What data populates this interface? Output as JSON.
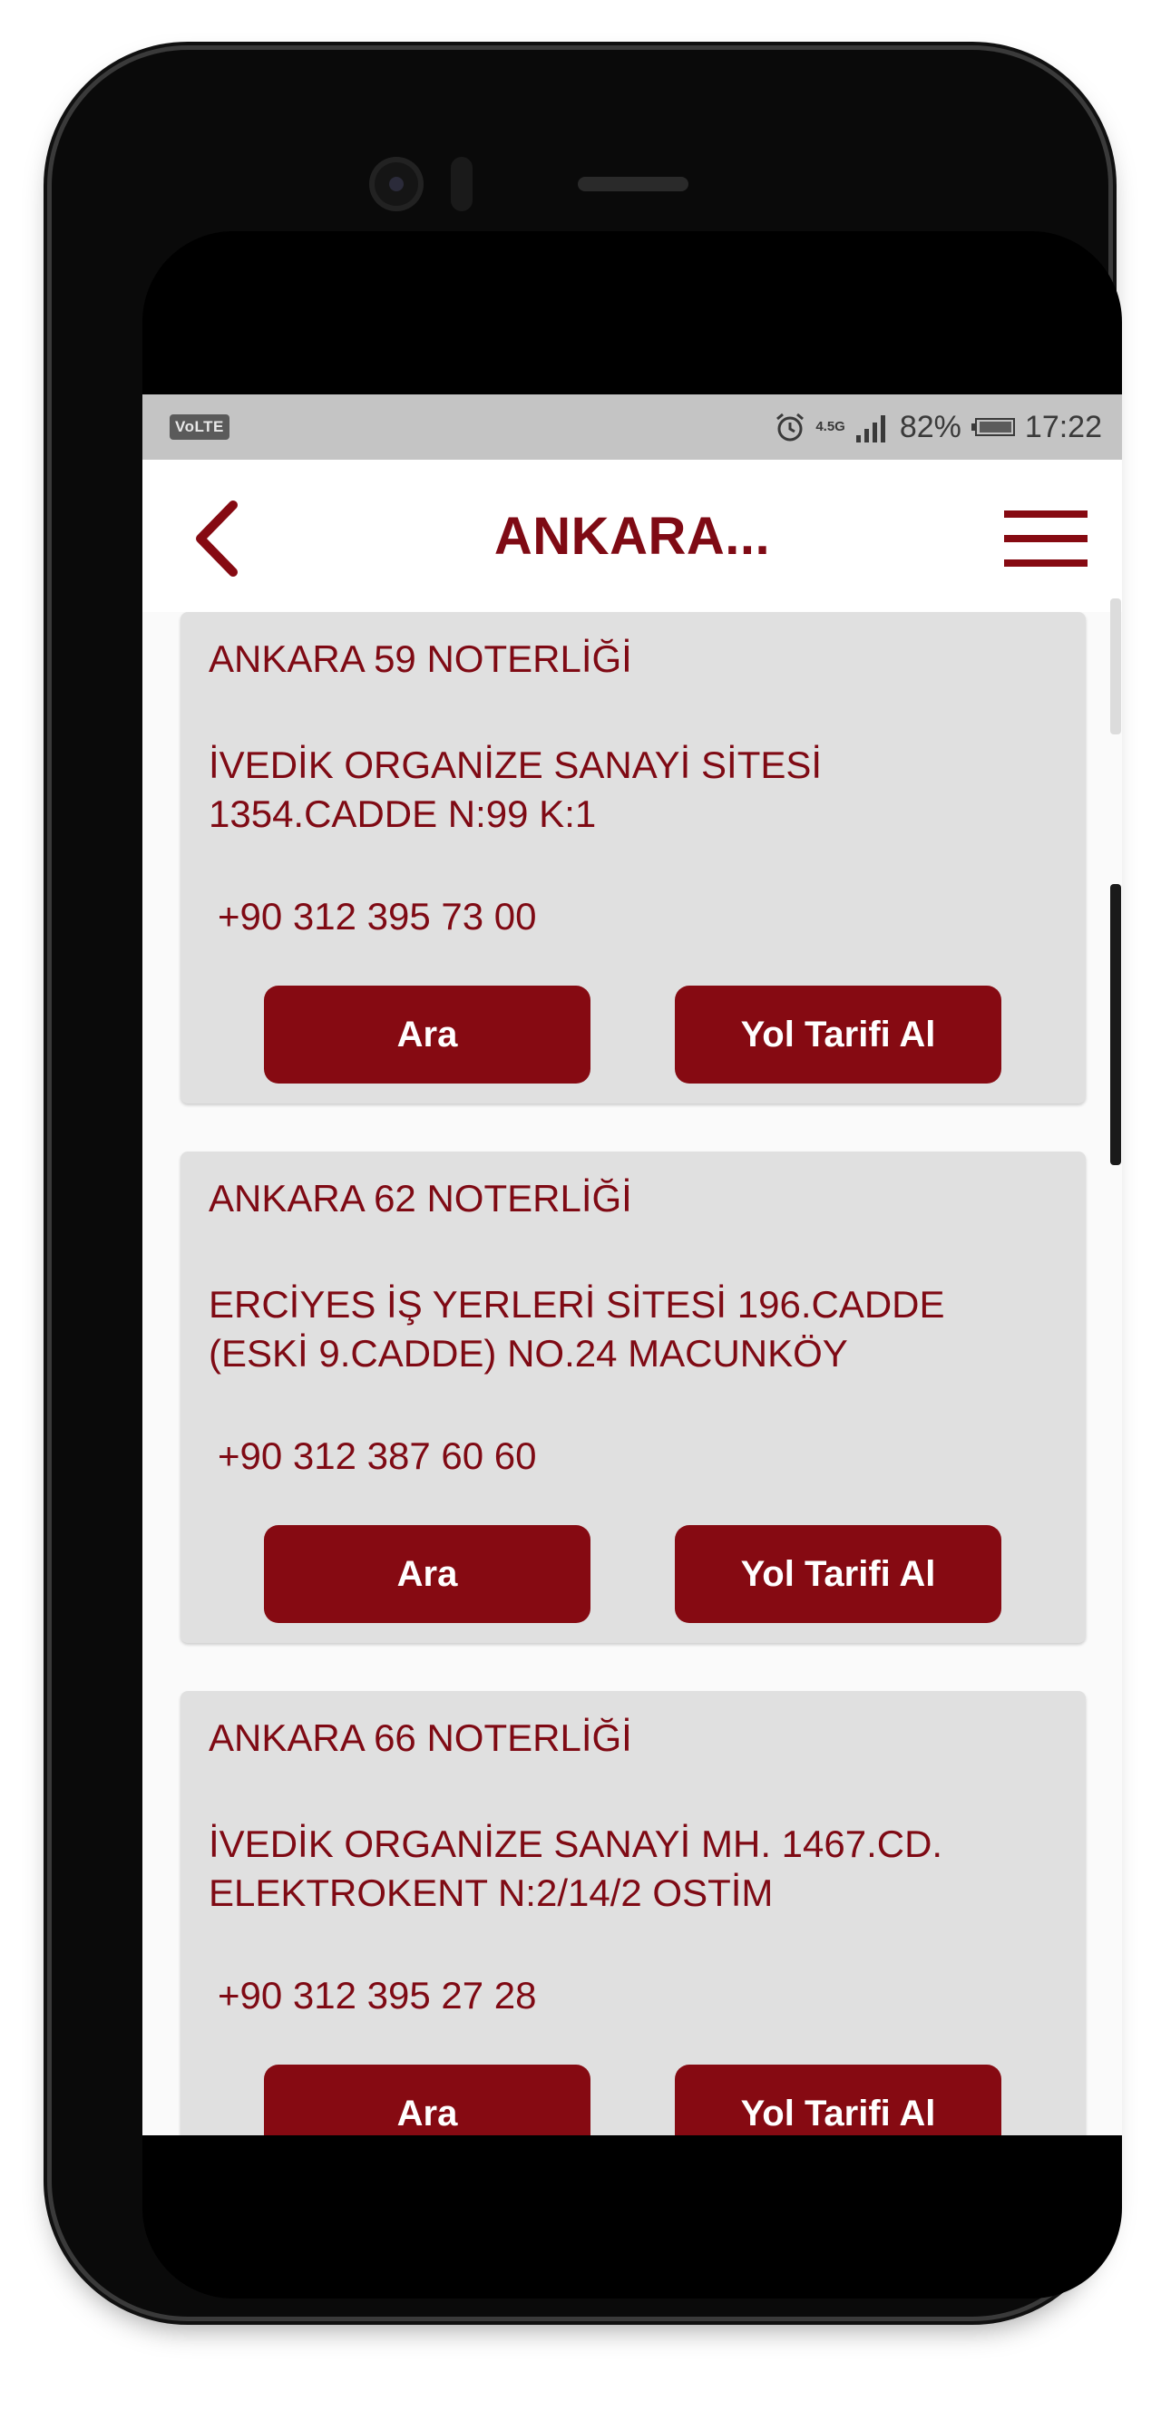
{
  "status_bar": {
    "volte": "VoLTE",
    "network": "4.5G",
    "battery": "82%",
    "time": "17:22",
    "icons": [
      "alarm-icon",
      "signal-icon",
      "battery-icon"
    ]
  },
  "header": {
    "title": "ANKARA...",
    "back_icon": "chevron-left-icon",
    "menu_icon": "hamburger-menu-icon"
  },
  "colors": {
    "accent": "#7f0a14",
    "button": "#860a12",
    "card_bg": "#e0e0e0",
    "status_bar_bg": "#c4c4c4"
  },
  "notaries": [
    {
      "name": "ANKARA 59 NOTERLİĞİ",
      "address": "İVEDİK ORGANİZE SANAYİ SİTESİ 1354.CADDE N:99 K:1",
      "phone": "+90 312 395 73 00",
      "call_label": "Ara",
      "route_label": "Yol Tarifi Al"
    },
    {
      "name": "ANKARA 62 NOTERLİĞİ",
      "address": "ERCİYES İŞ YERLERİ SİTESİ 196.CADDE (ESKİ 9.CADDE) NO.24 MACUNKÖY",
      "phone": "+90 312 387 60 60",
      "call_label": "Ara",
      "route_label": "Yol Tarifi Al"
    },
    {
      "name": "ANKARA 66 NOTERLİĞİ",
      "address": "İVEDİK ORGANİZE SANAYİ MH. 1467.CD. ELEKTROKENT N:2/14/2 OSTİM",
      "phone": "+90 312 395 27 28",
      "call_label": "Ara",
      "route_label": "Yol Tarifi Al"
    }
  ]
}
